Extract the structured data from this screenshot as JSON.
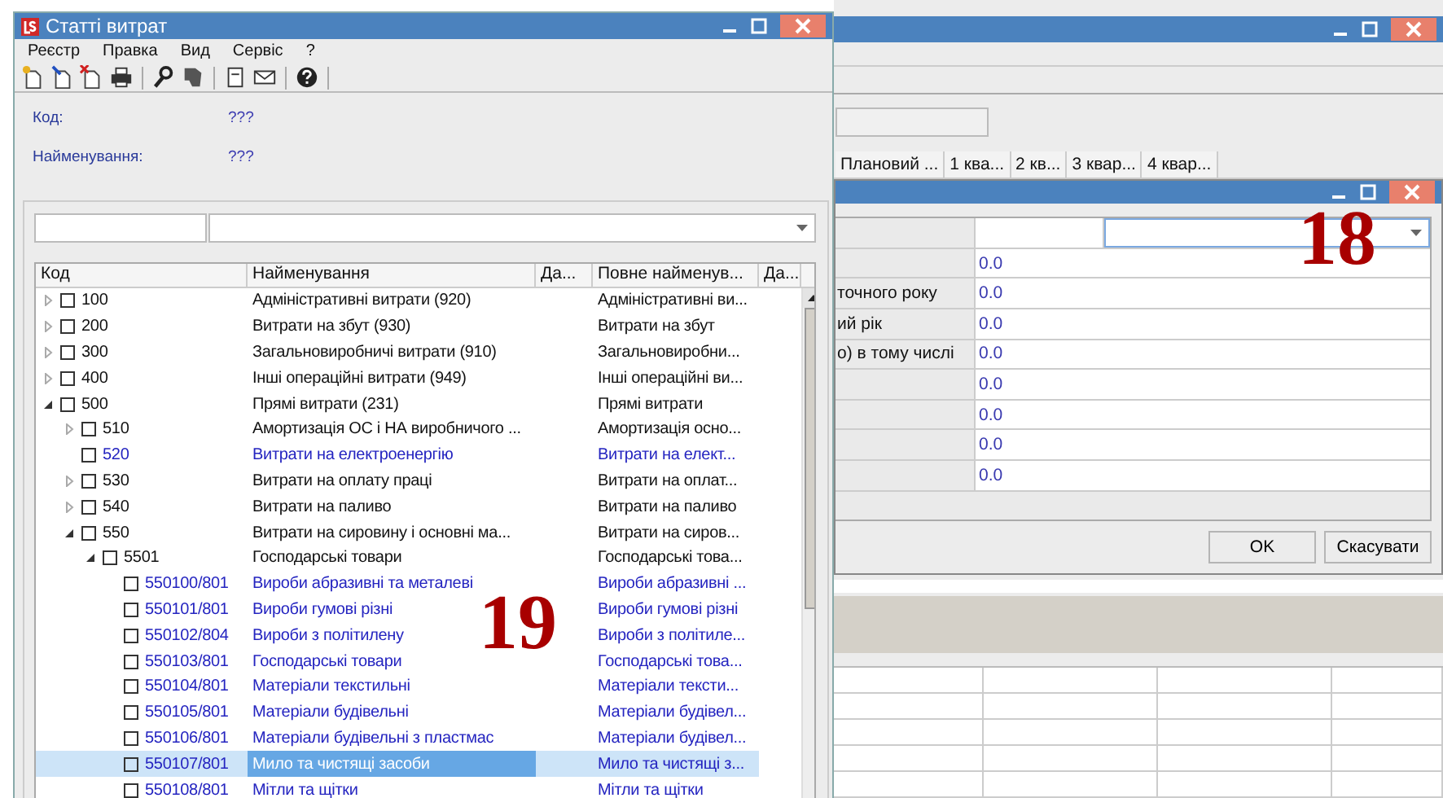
{
  "back_window": {
    "columns": [
      "Плановий ...",
      "1 ква...",
      "2 кв...",
      "3 квар...",
      "4 квар..."
    ]
  },
  "dialog": {
    "rows": [
      {
        "label": "",
        "value": ""
      },
      {
        "label": "",
        "value": "0.0"
      },
      {
        "label": "точного року",
        "value": "0.0"
      },
      {
        "label": "ий рік",
        "value": "0.0"
      },
      {
        "label": "о) в тому числі",
        "value": "0.0"
      },
      {
        "label": "",
        "value": "0.0"
      },
      {
        "label": "",
        "value": "0.0"
      },
      {
        "label": "",
        "value": "0.0"
      },
      {
        "label": "",
        "value": "0.0"
      }
    ],
    "buttons": [
      "OK",
      "Скасувати"
    ]
  },
  "left_window": {
    "title": "Статті витрат",
    "menu": [
      "Реєстр",
      "Правка",
      "Вид",
      "Сервіс",
      "?"
    ],
    "fields": [
      {
        "label": "Код:",
        "value": "???"
      },
      {
        "label": "Найменування:",
        "value": "???"
      }
    ],
    "tree": {
      "columns": [
        "Код",
        "Найменування",
        "Да...",
        "Повне найменув...",
        "Да..."
      ],
      "rows": [
        {
          "kind": "group",
          "expanded": false,
          "checked": false,
          "selected": false,
          "code": "100",
          "name": "Адміністративні витрати (920)",
          "full_name": "Адміністративні ви..."
        },
        {
          "kind": "group",
          "expanded": false,
          "checked": false,
          "selected": false,
          "code": "200",
          "name": "Витрати на збут (930)",
          "full_name": "Витрати на збут"
        },
        {
          "kind": "group",
          "expanded": false,
          "checked": false,
          "selected": false,
          "code": "300",
          "name": "Загальновиробничі витрати (910)",
          "full_name": "Загальновиробни..."
        },
        {
          "kind": "group",
          "expanded": false,
          "checked": false,
          "selected": false,
          "code": "400",
          "name": "Інші операційні витрати (949)",
          "full_name": "Інші операційні ви..."
        },
        {
          "kind": "group",
          "expanded": true,
          "checked": false,
          "selected": false,
          "code": "500",
          "name": "Прямі витрати (231)",
          "full_name": "Прямі витрати",
          "children": [
            {
              "kind": "group",
              "expanded": false,
              "checked": false,
              "selected": false,
              "code": "510",
              "name": "Амортизація ОС і НА виробничого ...",
              "full_name": "Амортизація осно..."
            },
            {
              "kind": "item",
              "checked": false,
              "selected": false,
              "code": "520",
              "name": "Витрати на електроенергію",
              "full_name": "Витрати на елект..."
            },
            {
              "kind": "group",
              "expanded": false,
              "checked": false,
              "selected": false,
              "code": "530",
              "name": "Витрати на оплату праці",
              "full_name": "Витрати на оплат..."
            },
            {
              "kind": "group",
              "expanded": false,
              "checked": false,
              "selected": false,
              "code": "540",
              "name": "Витрати на паливо",
              "full_name": "Витрати на паливо"
            },
            {
              "kind": "group",
              "expanded": true,
              "checked": false,
              "selected": false,
              "code": "550",
              "name": "Витрати на сировину і основні ма...",
              "full_name": "Витрати на сиров...",
              "children": [
                {
                  "kind": "group",
                  "expanded": true,
                  "checked": false,
                  "selected": false,
                  "code": "5501",
                  "name": "Господарські товари",
                  "full_name": "Господарські това...",
                  "children": [
                    {
                      "kind": "item",
                      "checked": false,
                      "selected": false,
                      "code": "550100/801",
                      "name": "Вироби абразивні та металеві",
                      "full_name": "Вироби абразивні ..."
                    },
                    {
                      "kind": "item",
                      "checked": false,
                      "selected": false,
                      "code": "550101/801",
                      "name": "Вироби гумові різні",
                      "full_name": "Вироби гумові різні"
                    },
                    {
                      "kind": "item",
                      "checked": false,
                      "selected": false,
                      "code": "550102/804",
                      "name": "Вироби з політилену",
                      "full_name": "Вироби з політиле..."
                    },
                    {
                      "kind": "item",
                      "checked": false,
                      "selected": false,
                      "code": "550103/801",
                      "name": "Господарські товари",
                      "full_name": "Господарські това..."
                    },
                    {
                      "kind": "item",
                      "checked": false,
                      "selected": false,
                      "code": "550104/801",
                      "name": "Матеріали  текстильні",
                      "full_name": "Матеріали  тексти..."
                    },
                    {
                      "kind": "item",
                      "checked": false,
                      "selected": false,
                      "code": "550105/801",
                      "name": "Матеріали будівельні",
                      "full_name": "Матеріали будівел..."
                    },
                    {
                      "kind": "item",
                      "checked": false,
                      "selected": false,
                      "code": "550106/801",
                      "name": "Матеріали будівельні з пластмас",
                      "full_name": "Матеріали будівел..."
                    },
                    {
                      "kind": "item",
                      "checked": false,
                      "selected": true,
                      "code": "550107/801",
                      "name": "Мило та чистящі засоби",
                      "full_name": "Мило та чистящі з..."
                    },
                    {
                      "kind": "item",
                      "checked": false,
                      "selected": false,
                      "code": "550108/801",
                      "name": "Мітли та щітки",
                      "full_name": "Мітли та щітки"
                    }
                  ]
                }
              ]
            }
          ]
        }
      ]
    }
  },
  "annotations": [
    "18",
    "19"
  ]
}
